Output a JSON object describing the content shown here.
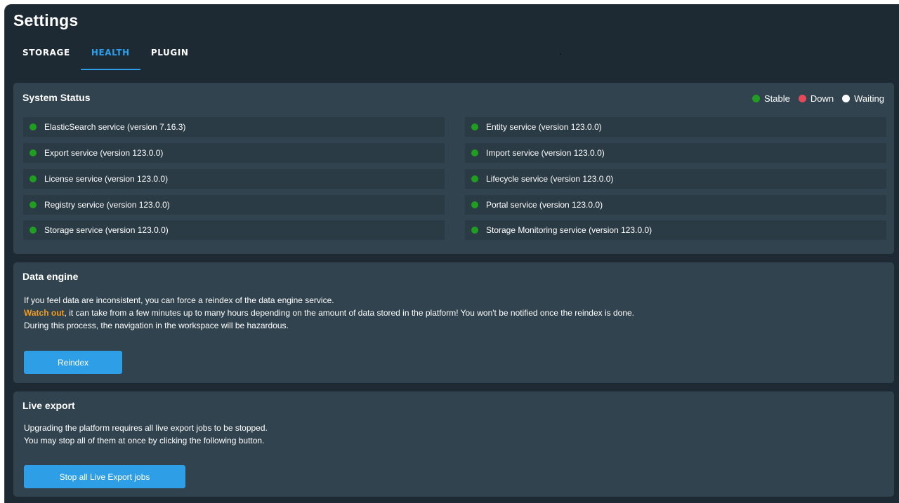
{
  "header": {
    "title": "Settings"
  },
  "tabs": [
    {
      "label": "STORAGE"
    },
    {
      "label": "HEALTH"
    },
    {
      "label": "PLUGIN"
    }
  ],
  "system_status": {
    "title": "System Status",
    "legend": [
      {
        "label": "Stable",
        "color": "#1f9e1f"
      },
      {
        "label": "Down",
        "color": "#e64a5a"
      },
      {
        "label": "Waiting",
        "color": "#ffffff"
      }
    ],
    "services": [
      {
        "label": "ElasticSearch service (version 7.16.3)",
        "status": "stable"
      },
      {
        "label": "Entity service (version 123.0.0)",
        "status": "stable"
      },
      {
        "label": "Export service (version 123.0.0)",
        "status": "stable"
      },
      {
        "label": "Import service (version 123.0.0)",
        "status": "stable"
      },
      {
        "label": "License service (version 123.0.0)",
        "status": "stable"
      },
      {
        "label": "Lifecycle service (version 123.0.0)",
        "status": "stable"
      },
      {
        "label": "Registry service (version 123.0.0)",
        "status": "stable"
      },
      {
        "label": "Portal service (version 123.0.0)",
        "status": "stable"
      },
      {
        "label": "Storage service (version 123.0.0)",
        "status": "stable"
      },
      {
        "label": "Storage Monitoring service (version 123.0.0)",
        "status": "stable"
      }
    ]
  },
  "data_engine": {
    "title": "Data engine",
    "line1": "If you feel data are inconsistent, you can force a reindex of the data engine service.",
    "warn_prefix": "Watch out",
    "line2_rest": ", it can take from a few minutes up to many hours depending on the amount of data stored in the platform! You won't be notified once the reindex is done.",
    "line3": "During this process, the navigation in the workspace will be hazardous.",
    "button_label": "Reindex"
  },
  "live_export": {
    "title": "Live export",
    "line1": "Upgrading the platform requires all live export jobs to be stopped.",
    "line2": "You may stop all of them at once by clicking the following button.",
    "button_label": "Stop all Live Export jobs"
  }
}
